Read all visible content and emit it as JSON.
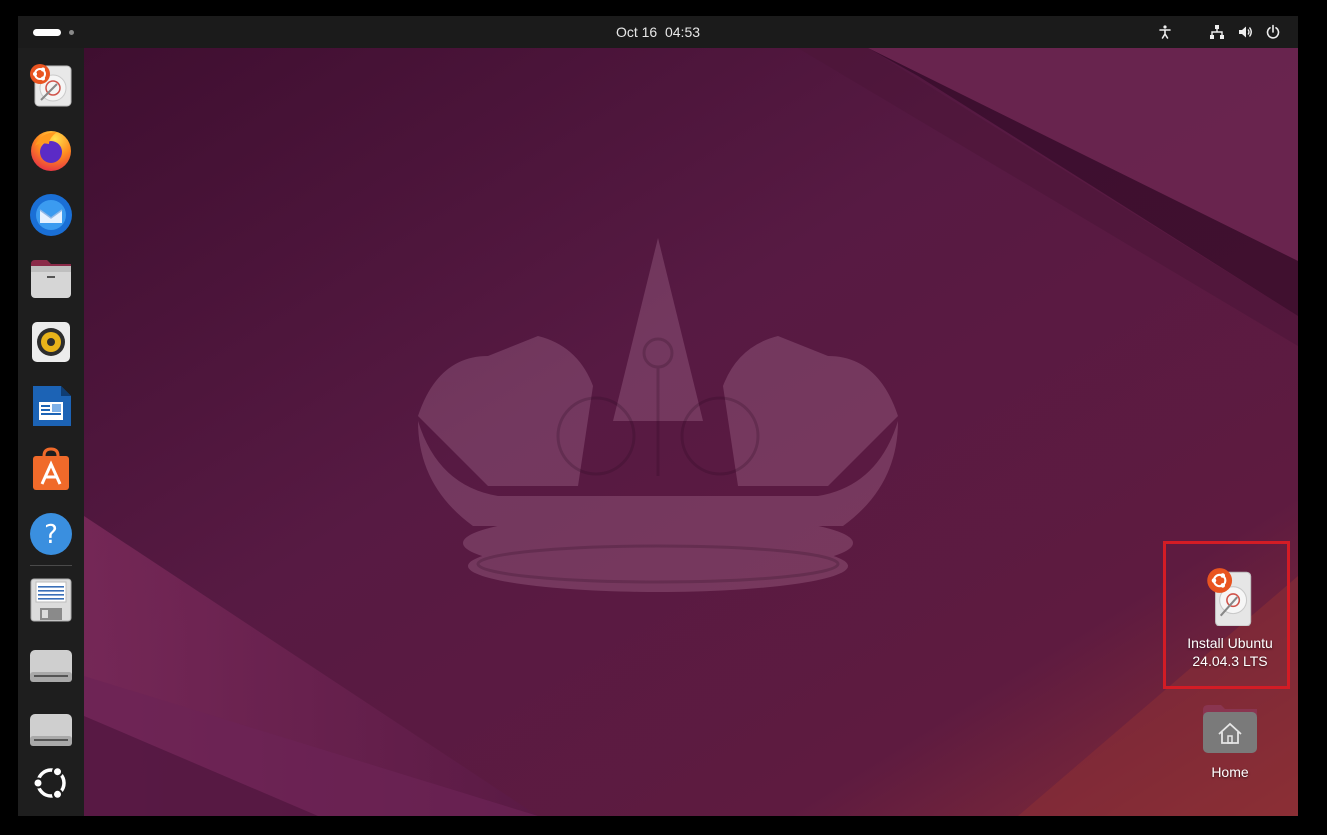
{
  "topbar": {
    "clock": "Oct 16  04:53",
    "tray_icons": [
      "accessibility-icon",
      "network-icon",
      "volume-icon",
      "power-icon"
    ]
  },
  "dock": {
    "items": [
      {
        "name": "install-ubuntu-icon"
      },
      {
        "name": "firefox-icon"
      },
      {
        "name": "thunderbird-icon"
      },
      {
        "name": "files-icon"
      },
      {
        "name": "rhythmbox-icon"
      },
      {
        "name": "libreoffice-writer-icon"
      },
      {
        "name": "app-center-icon"
      },
      {
        "name": "help-icon"
      },
      {
        "name": "save-document-icon"
      },
      {
        "name": "drive-icon"
      },
      {
        "name": "drive-icon"
      },
      {
        "name": "ubuntu-logo-icon"
      }
    ]
  },
  "desktop": {
    "install_label": "Install Ubuntu\n24.04.3 LTS",
    "home_label": "Home"
  },
  "colors": {
    "accent": "#e95420",
    "selection": "#d31c25",
    "wallpaper_base": "#4a1237"
  }
}
